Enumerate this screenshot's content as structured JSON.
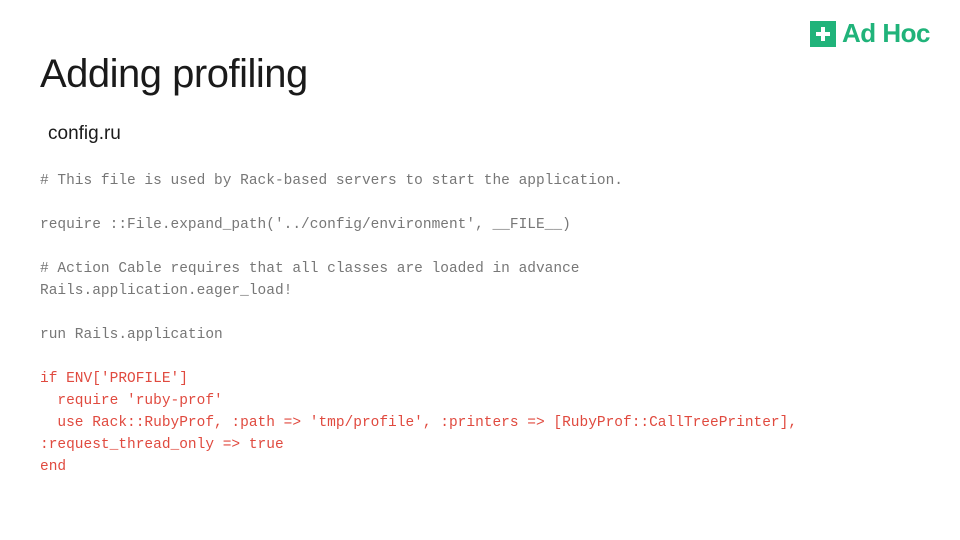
{
  "brand": {
    "name": "Ad Hoc",
    "accent": "#20b37a"
  },
  "title": "Adding profiling",
  "subtitle": "config.ru",
  "code": {
    "line1": "# This file is used by Rack-based servers to start the application.",
    "line2": "",
    "line3": "require ::File.expand_path('../config/environment', __FILE__)",
    "line4": "",
    "line5": "# Action Cable requires that all classes are loaded in advance",
    "line6": "Rails.application.eager_load!",
    "line7": "",
    "line8": "run Rails.application",
    "line9": "",
    "line10": "if ENV['PROFILE']",
    "line11": "  require 'ruby-prof'",
    "line12": "  use Rack::RubyProf, :path => 'tmp/profile', :printers => [RubyProf::CallTreePrinter], :request_thread_only => true",
    "line13": "end"
  }
}
